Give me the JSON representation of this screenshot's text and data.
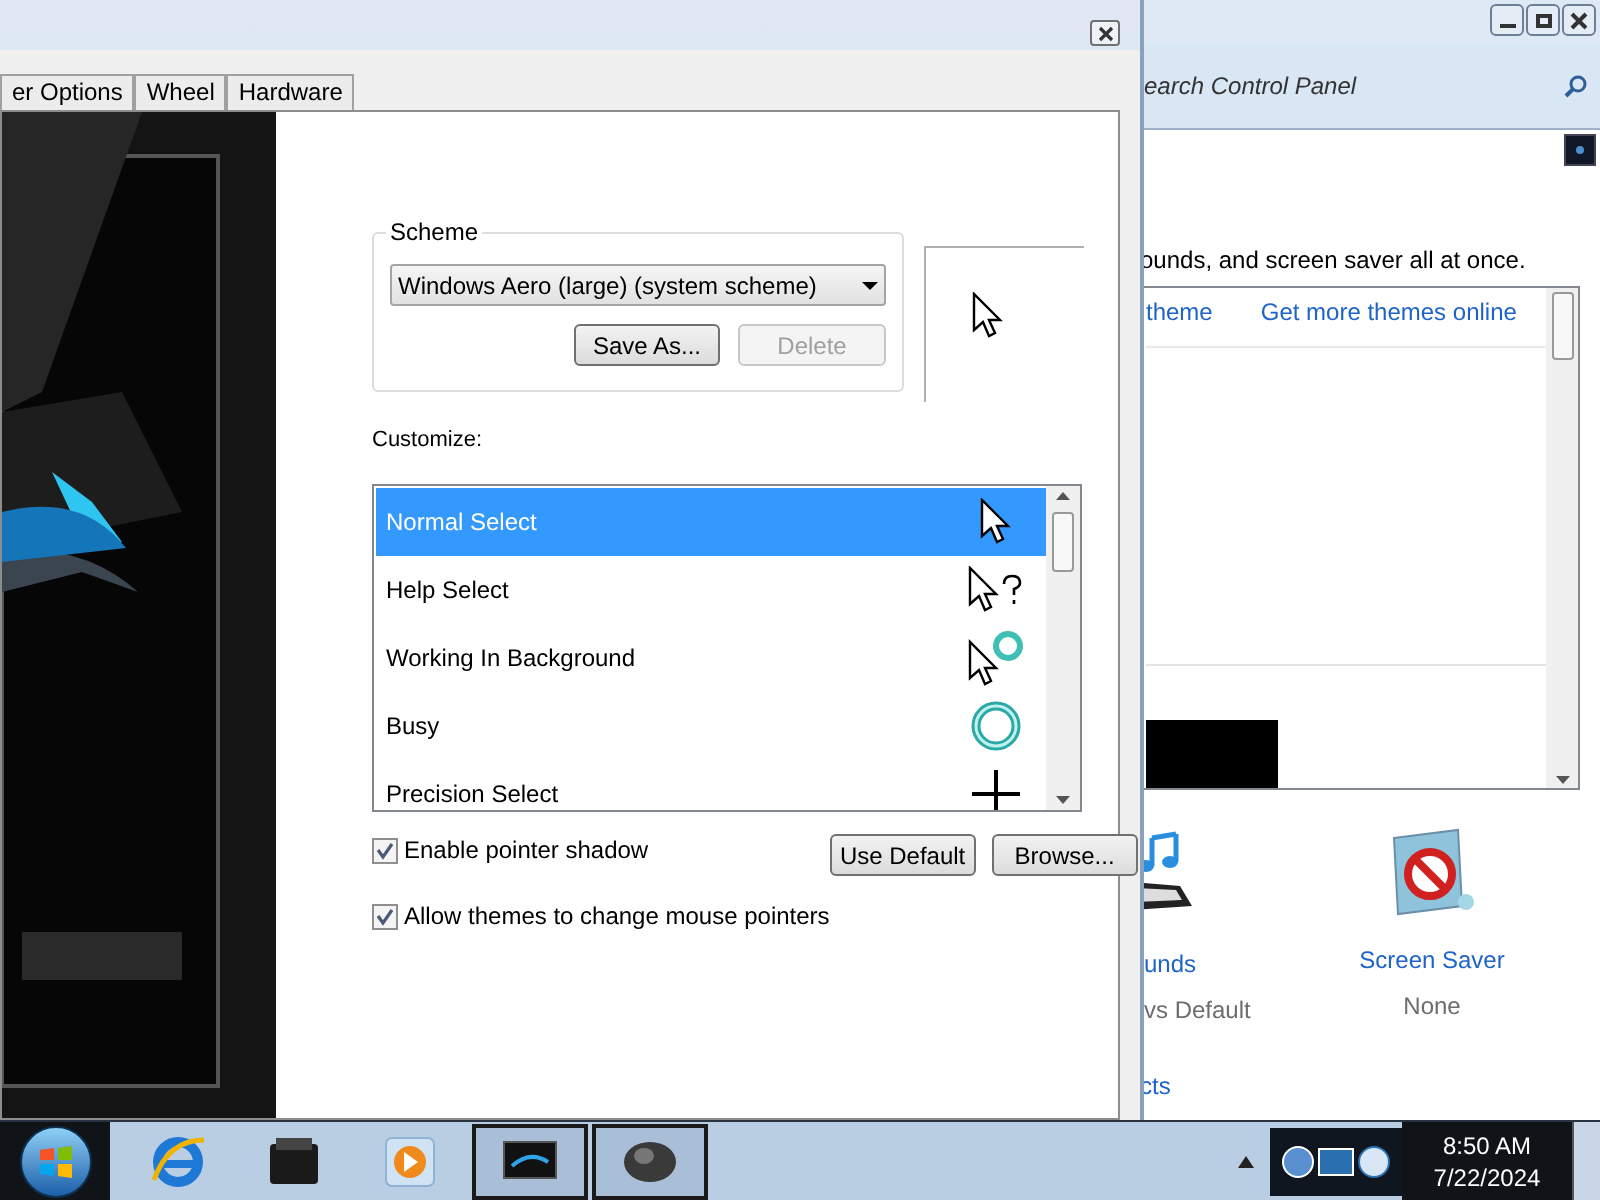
{
  "dialog": {
    "tabs": [
      {
        "label": "er Options",
        "selected": false
      },
      {
        "label": "Wheel",
        "selected": false
      },
      {
        "label": "Hardware",
        "selected": false
      }
    ],
    "scheme": {
      "label": "Scheme",
      "value": "Windows Aero (large) (system scheme)",
      "buttons": [
        {
          "label": "Save As...",
          "disabled": false
        },
        {
          "label": "Delete",
          "disabled": true
        }
      ]
    },
    "customize_label": "Customize:",
    "cursors": [
      {
        "name": "Normal Select",
        "selected": true,
        "kind": "arrow"
      },
      {
        "name": "Help Select",
        "selected": false,
        "kind": "help"
      },
      {
        "name": "Working In Background",
        "selected": false,
        "kind": "working"
      },
      {
        "name": "Busy",
        "selected": false,
        "kind": "busy"
      },
      {
        "name": "Precision Select",
        "selected": false,
        "kind": "cross"
      }
    ],
    "options": [
      {
        "label": "Enable pointer shadow",
        "checked": true
      },
      {
        "label": "Allow themes to change mouse pointers",
        "checked": true
      }
    ],
    "buttons": [
      "Use Default",
      "Browse..."
    ]
  },
  "control_panel": {
    "search": {
      "placeholder": "earch Control Panel"
    },
    "description": "ounds, and screen saver all at once.",
    "links": [
      "theme",
      "Get more themes online"
    ],
    "items": [
      {
        "kind": "sounds",
        "title": "unds",
        "subtitle": "vs Default"
      },
      {
        "kind": "screensaver",
        "title": "Screen Saver",
        "subtitle": "None"
      }
    ],
    "footer_link": "cts"
  },
  "taskbar": {
    "apps": [
      {
        "kind": "browser",
        "active": false
      },
      {
        "kind": "folder",
        "active": false
      },
      {
        "kind": "media",
        "active": false
      },
      {
        "kind": "monitor",
        "active": true
      },
      {
        "kind": "mouse",
        "active": true
      }
    ],
    "clock": {
      "time": "8:50 AM",
      "date": "7/22/2024"
    }
  }
}
